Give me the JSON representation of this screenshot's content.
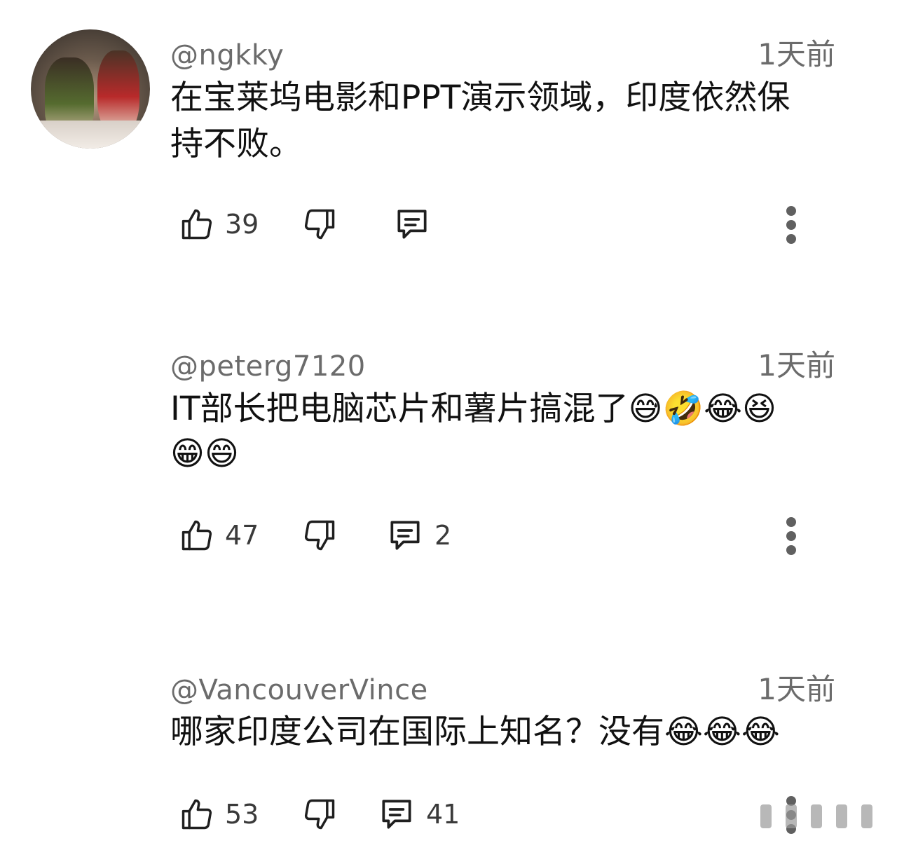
{
  "comments": [
    {
      "handle": "@ngkky",
      "time": "1天前",
      "text_line1": "在宝莱坞电影和PPT演示领域，印度依然保",
      "text_line2": "持不败。",
      "likes": "39",
      "replies": ""
    },
    {
      "handle": "@peterg7120",
      "time": "1天前",
      "text_line1": "IT部长把电脑芯片和薯片搞混了😅🤣😂😆",
      "text_line2": "😁😄",
      "likes": "47",
      "replies": "2"
    },
    {
      "handle": "@VancouverVince",
      "time": "1天前",
      "text_line1": "哪家印度公司在国际上知名？没有😂😂😂",
      "text_line2": "",
      "likes": "53",
      "replies": "41"
    }
  ],
  "icons": {
    "like": "thumbs-up-icon",
    "dislike": "thumbs-down-icon",
    "reply": "comment-icon",
    "more": "more-vertical-icon"
  }
}
